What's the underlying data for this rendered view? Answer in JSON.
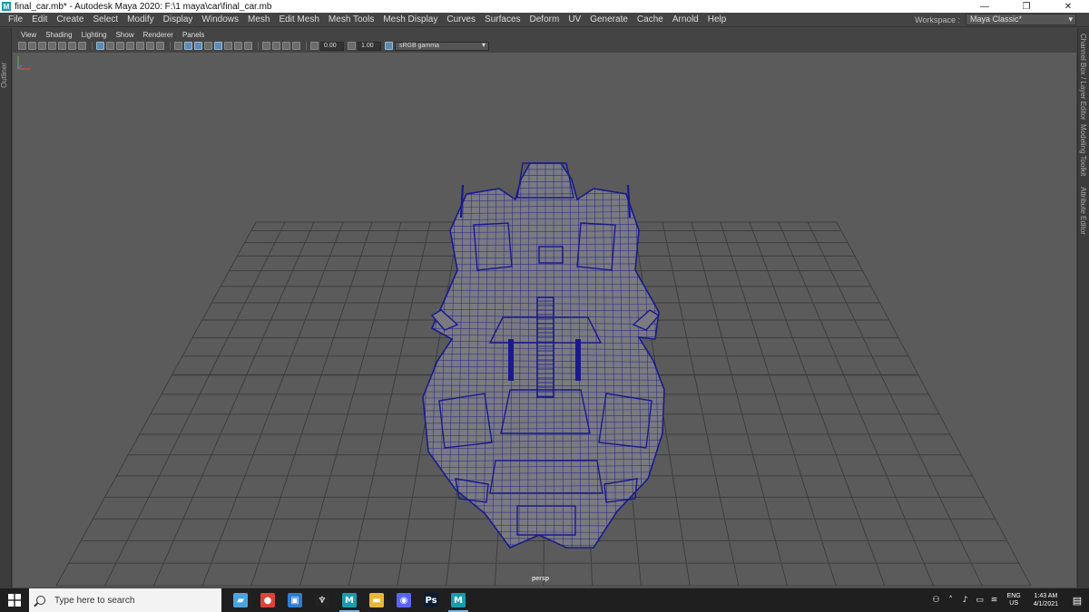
{
  "window": {
    "title": "final_car.mb* - Autodesk Maya 2020: F:\\1 maya\\car\\final_car.mb",
    "logo": "M",
    "minimize": "—",
    "restore": "❐",
    "close": "✕"
  },
  "menubar": {
    "items": [
      "File",
      "Edit",
      "Create",
      "Select",
      "Modify",
      "Display",
      "Windows",
      "Mesh",
      "Edit Mesh",
      "Mesh Tools",
      "Mesh Display",
      "Curves",
      "Surfaces",
      "Deform",
      "UV",
      "Generate",
      "Cache",
      "Arnold",
      "Help"
    ],
    "workspace_label": "Workspace :",
    "workspace_value": "Maya Classic*"
  },
  "left_strip": {
    "tab": "Outliner"
  },
  "right_strip": {
    "tabs": [
      "Channel Box / Layer Editor",
      "Modeling Toolkit",
      "Attribute Editor"
    ]
  },
  "panel_menu": {
    "items": [
      "View",
      "Shading",
      "Lighting",
      "Show",
      "Renderer",
      "Panels"
    ]
  },
  "panel_toolbar": {
    "exposure": "0.00",
    "gamma": "1.00",
    "color_space": "sRGB gamma"
  },
  "viewport": {
    "camera": "persp",
    "colors": {
      "background": "#5b5b5b",
      "grid": "#3e3e3e",
      "wireframe": "#1a1a8c",
      "mesh_fill": "#7a7a80"
    }
  },
  "taskbar": {
    "search_placeholder": "Type here to search",
    "apps": [
      {
        "name": "files-app-icon",
        "glyph": "▰",
        "color": "#4aa3df"
      },
      {
        "name": "chrome-icon",
        "glyph": "●",
        "color": "#db4437"
      },
      {
        "name": "photos-icon",
        "glyph": "▣",
        "color": "#2d7dd2"
      },
      {
        "name": "alienware-icon",
        "glyph": "♆",
        "color": "#222222"
      },
      {
        "name": "maya-icon",
        "glyph": "M",
        "color": "#1b9bb0"
      },
      {
        "name": "file-explorer-icon",
        "glyph": "▬",
        "color": "#e8b73a"
      },
      {
        "name": "discord-icon",
        "glyph": "◉",
        "color": "#5865f2"
      },
      {
        "name": "photoshop-icon",
        "glyph": "Ps",
        "color": "#0c1d33"
      },
      {
        "name": "maya-active-icon",
        "glyph": "M",
        "color": "#1b9bb0"
      }
    ],
    "lang_line1": "ENG",
    "lang_line2": "US",
    "time": "1:43 AM",
    "date": "4/1/2021"
  }
}
